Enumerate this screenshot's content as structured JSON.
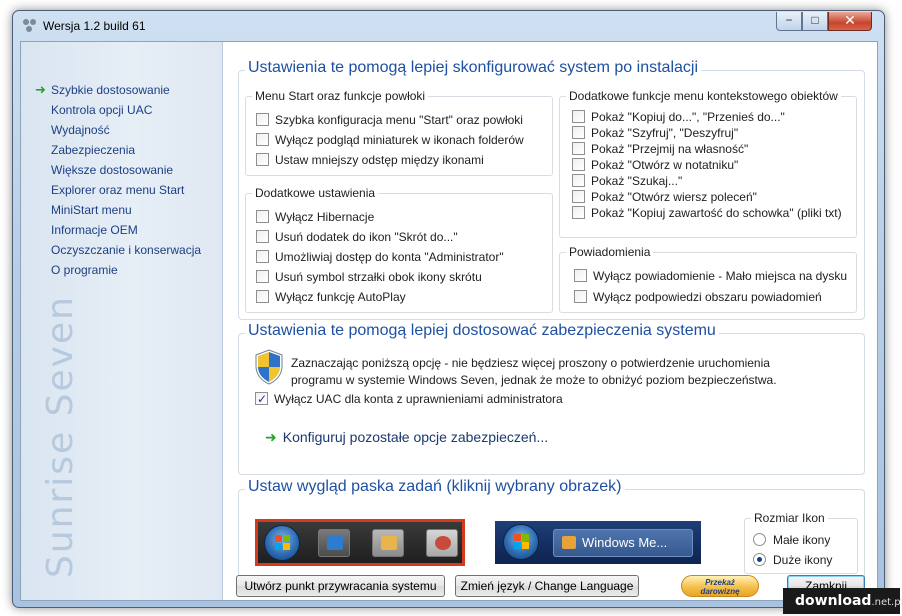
{
  "window": {
    "title": "Wersja 1.2 build 61",
    "controls": {
      "minimize": "−",
      "maximize": "□",
      "close": "✕"
    }
  },
  "sidebar": {
    "items": [
      {
        "label": "Szybkie dostosowanie",
        "active": true
      },
      {
        "label": "Kontrola opcji UAC"
      },
      {
        "label": "Wydajność"
      },
      {
        "label": "Zabezpieczenia"
      },
      {
        "label": "Większe dostosowanie"
      },
      {
        "label": "Explorer oraz menu Start"
      },
      {
        "label": "MiniStart menu"
      },
      {
        "label": "Informacje OEM"
      },
      {
        "label": "Oczyszczanie i konserwacja"
      },
      {
        "label": "O programie"
      }
    ],
    "brand": "Sunrise Seven",
    "active_arrow": "➜"
  },
  "section_setup": {
    "title": "Ustawienia te pomogą lepiej skonfigurować system po instalacji",
    "start_menu_group": {
      "title": "Menu Start oraz funkcje powłoki",
      "options": [
        {
          "label": "Szybka konfiguracja menu \"Start\" oraz powłoki",
          "checked": false
        },
        {
          "label": "Wyłącz podgląd miniaturek w ikonach folderów",
          "checked": false
        },
        {
          "label": "Ustaw mniejszy odstęp między ikonami",
          "checked": false
        }
      ]
    },
    "additional_group": {
      "title": "Dodatkowe ustawienia",
      "options": [
        {
          "label": "Wyłącz Hibernacje",
          "checked": false
        },
        {
          "label": "Usuń dodatek do ikon \"Skrót do...\"",
          "checked": false
        },
        {
          "label": "Umożliwiaj dostęp do konta \"Administrator\"",
          "checked": false
        },
        {
          "label": "Usuń symbol strzałki obok ikony skrótu",
          "checked": false
        },
        {
          "label": "Wyłącz funkcję AutoPlay",
          "checked": false
        }
      ]
    },
    "context_group": {
      "title": "Dodatkowe funkcje menu kontekstowego obiektów",
      "options": [
        {
          "label": "Pokaż \"Kopiuj do...\", \"Przenieś do...\"",
          "checked": false
        },
        {
          "label": "Pokaż \"Szyfruj\", \"Deszyfruj\"",
          "checked": false
        },
        {
          "label": "Pokaż \"Przejmij na własność\"",
          "checked": false
        },
        {
          "label": "Pokaż \"Otwórz w notatniku\"",
          "checked": false
        },
        {
          "label": "Pokaż \"Szukaj...\"",
          "checked": false
        },
        {
          "label": "Pokaż \"Otwórz wiersz poleceń\"",
          "checked": false
        },
        {
          "label": "Pokaż \"Kopiuj zawartość do schowka\" (pliki txt)",
          "checked": false
        }
      ]
    },
    "notifications_group": {
      "title": "Powiadomienia",
      "options": [
        {
          "label": "Wyłącz powiadomienie - Mało miejsca na dysku",
          "checked": false
        },
        {
          "label": "Wyłącz podpowiedzi obszaru powiadomień",
          "checked": false
        }
      ]
    }
  },
  "section_security": {
    "title": "Ustawienia te pomogą lepiej dostosować zabezpieczenia systemu",
    "description_line1": "Zaznaczając poniższą opcję - nie będziesz więcej proszony o potwierdzenie uruchomienia",
    "description_line2": "programu w systemie Windows Seven, jednak że może to obniżyć poziom bezpieczeństwa.",
    "uac_option": {
      "label": "Wyłącz UAC dla konta z uprawnieniami administratora",
      "checked": true
    },
    "config_link": "Konfiguruj pozostałe opcje zabezpieczeń...",
    "link_arrow": "➜"
  },
  "section_taskbar": {
    "title": "Ustaw wygląd paska zadań (kliknij wybrany obrazek)",
    "preview_b_label": "Windows Me...",
    "icon_size_group": {
      "title": "Rozmiar Ikon",
      "options": [
        {
          "label": "Małe ikony",
          "selected": false
        },
        {
          "label": "Duże ikony",
          "selected": true
        }
      ]
    }
  },
  "footer": {
    "restore_point_button": "Utwórz punkt przywracania systemu",
    "language_button": "Zmień język / Change Language",
    "donate_line1": "Przekaż",
    "donate_line2": "darowiznę",
    "close_button": "Zamknij"
  },
  "watermark": {
    "brand": "download",
    "suffix": ".net.pl"
  },
  "colors": {
    "accent_title": "#1e50a2",
    "nav_link": "#1d3f84",
    "arrow_green": "#2aa22a",
    "selected_preview_border": "#d33a1e"
  }
}
